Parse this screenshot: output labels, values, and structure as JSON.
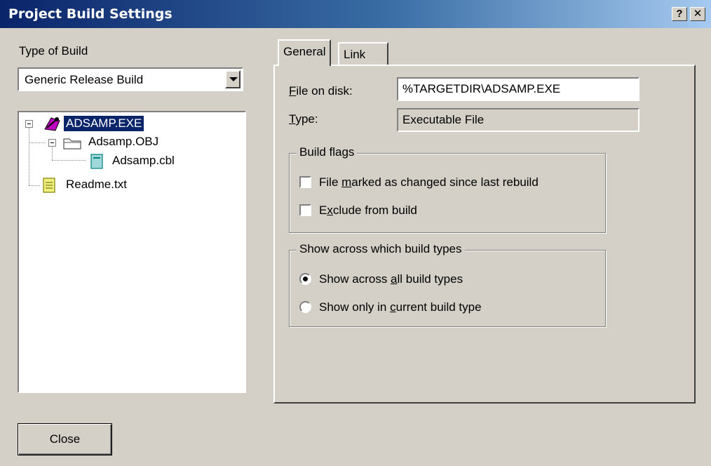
{
  "window": {
    "title": "Project Build Settings",
    "help_label": "?",
    "close_label": "✕"
  },
  "left": {
    "type_of_build_label": "Type of Build",
    "build_type_selected": "Generic Release Build",
    "tree": [
      {
        "label": "ADSAMP.EXE",
        "icon": "executable-icon",
        "selected": true
      },
      {
        "label": "Adsamp.OBJ",
        "icon": "folder-icon"
      },
      {
        "label": "Adsamp.cbl",
        "icon": "file-icon"
      },
      {
        "label": "Readme.txt",
        "icon": "text-file-icon"
      }
    ]
  },
  "tabs": [
    {
      "label": "General",
      "active": true
    },
    {
      "label": "Link",
      "active": false
    }
  ],
  "general": {
    "file_on_disk_label": "File on disk:",
    "file_on_disk_value": "%TARGETDIR\\ADSAMP.EXE",
    "type_label": "Type:",
    "type_value": "Executable File",
    "build_flags": {
      "legend": "Build flags",
      "file_marked_changed": "File marked as changed since last rebuild",
      "exclude_from_build": "Exclude from build"
    },
    "show_across": {
      "legend": "Show across which build types",
      "all_build_types": "Show across all build types",
      "current_build_type": "Show only in current build type",
      "selected": "all_build_types"
    }
  },
  "footer": {
    "close_label": "Close"
  },
  "colors": {
    "dialog_face": "#d4d0c8",
    "title_start": "#0a246a",
    "title_end": "#a6caf0",
    "selection": "#0a246a"
  }
}
